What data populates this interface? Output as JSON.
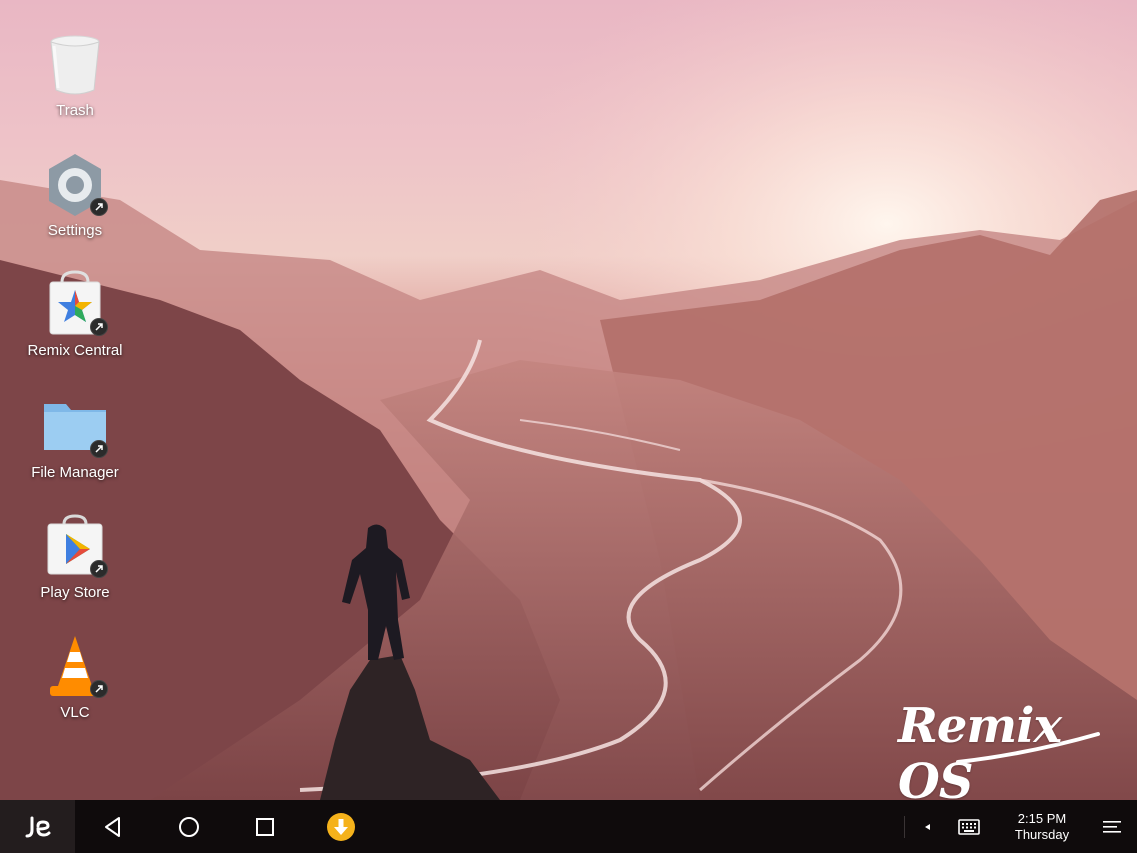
{
  "desktop": {
    "icons": [
      {
        "label": "Trash",
        "icon": "trash-icon"
      },
      {
        "label": "Settings",
        "icon": "gear-icon"
      },
      {
        "label": "Remix Central",
        "icon": "remix-central-icon"
      },
      {
        "label": "File Manager",
        "icon": "folder-icon"
      },
      {
        "label": "Play Store",
        "icon": "play-store-icon"
      },
      {
        "label": "VLC",
        "icon": "vlc-cone-icon"
      }
    ],
    "brand": "Remix OS"
  },
  "taskbar": {
    "start_icon": "remix-logo-icon",
    "nav": [
      "back-icon",
      "home-icon",
      "recents-icon"
    ],
    "download_icon": "download-icon",
    "tray": {
      "expand_icon": "caret-left-icon",
      "keyboard_icon": "keyboard-icon",
      "time": "2:15 PM",
      "day": "Thursday",
      "notifications_icon": "menu-icon"
    }
  },
  "colors": {
    "taskbar_bg": "#0f0b0c",
    "start_bg": "#231d1e",
    "download_accent": "#f5b21b",
    "folder_blue": "#8ec4ee"
  }
}
